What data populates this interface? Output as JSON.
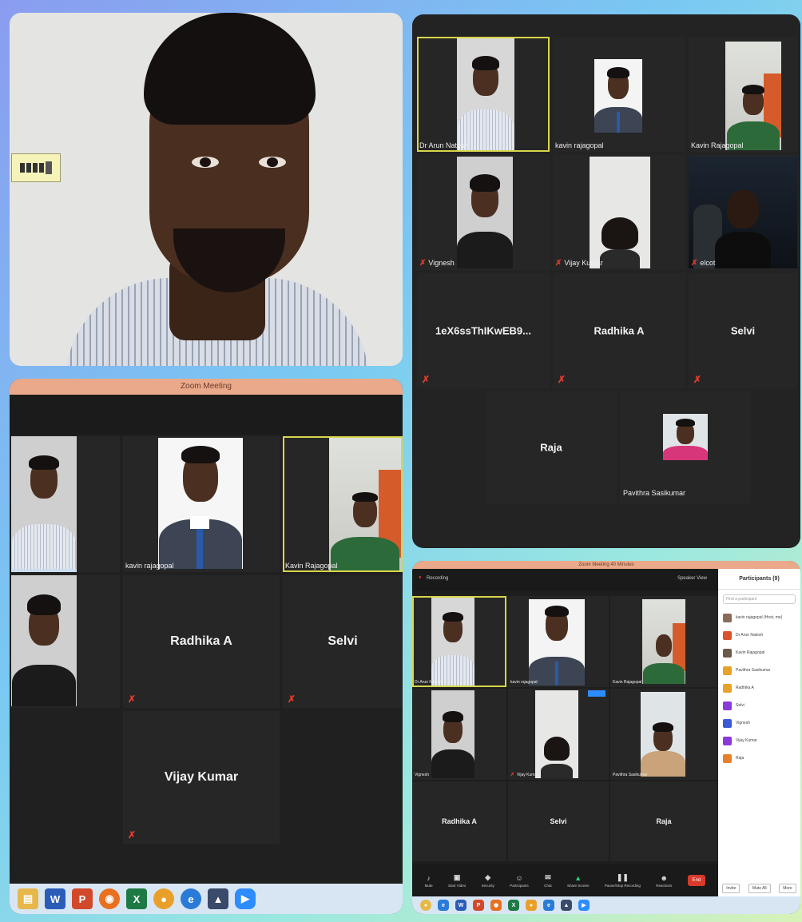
{
  "zoom_meeting_title": "Zoom Meeting",
  "zoom_participants_title": "Zoom Meeting 40 Minutes",
  "panel_b": {
    "tiles": [
      {
        "name": "Dr Arun Natesh",
        "video": true,
        "highlight": true
      },
      {
        "name": "kavin rajagopal",
        "video": true
      },
      {
        "name": "Kavin Rajagopal",
        "video": true
      },
      {
        "name": "Vignesh",
        "video": true,
        "muted": true
      },
      {
        "name": "Vijay Kumar",
        "video": true,
        "muted": true
      },
      {
        "name": "elcot",
        "video": true,
        "muted": true
      },
      {
        "name": "1eX6ssThIKwEB9...",
        "video": false,
        "muted": true
      },
      {
        "name": "Radhika A",
        "video": false,
        "muted": true
      },
      {
        "name": "Selvi",
        "video": false,
        "muted": true
      },
      {
        "name": "Raja",
        "video": false
      },
      {
        "name": "Pavithra Sasikumar",
        "video": true
      }
    ]
  },
  "panel_c": {
    "tiles": [
      {
        "name": "",
        "video": true
      },
      {
        "name": "kavin rajagopal",
        "video": true
      },
      {
        "name": "Kavin Rajagopal",
        "video": true,
        "highlight": true
      },
      {
        "name": "",
        "video": true
      },
      {
        "name": "Radhika A",
        "video": false,
        "muted": true
      },
      {
        "name": "Selvi",
        "video": false,
        "muted": true
      },
      {
        "name": "Vijay Kumar",
        "video": false,
        "muted": true
      }
    ],
    "taskbar_icons": [
      "file-explorer-icon",
      "word-icon",
      "powerpoint-icon",
      "firefox-icon",
      "excel-icon",
      "chrome-icon",
      "ie-icon",
      "vlc-icon",
      "zoom-icon"
    ]
  },
  "panel_d": {
    "top_left": "Recording",
    "top_right": "Speaker View",
    "tiles": [
      {
        "name": "Dr Arun Natesh",
        "video": true,
        "highlight": true
      },
      {
        "name": "kavin rajagopal",
        "video": true
      },
      {
        "name": "Kavin Rajagopal",
        "video": true
      },
      {
        "name": "Vignesh",
        "video": true
      },
      {
        "name": "Vijay Kumar",
        "video": true,
        "muted": true
      },
      {
        "name": "Pavithra Sasikumar",
        "video": true
      },
      {
        "name": "Radhika A",
        "video": false
      },
      {
        "name": "Selvi",
        "video": false
      },
      {
        "name": "Raja",
        "video": false
      }
    ],
    "toolbar": [
      "Mute",
      "Start Video",
      "Security",
      "Participants",
      "Chat",
      "Share Screen",
      "Pause/Stop Recording",
      "Reactions",
      "End"
    ],
    "sidebar": {
      "title": "Participants (9)",
      "search_placeholder": "Find a participant",
      "participants": [
        {
          "name": "kavin rajagopal (Host, me)",
          "color": "#8a6a5a"
        },
        {
          "name": "Dr Arun Natesh",
          "color": "#d9542a"
        },
        {
          "name": "Kavin Rajagopal",
          "color": "#6a5a4a"
        },
        {
          "name": "Pavithra Sasikumar",
          "color": "#e8a22a"
        },
        {
          "name": "Radhika A",
          "color": "#e8a22a"
        },
        {
          "name": "Selvi",
          "color": "#8a3ad9"
        },
        {
          "name": "Vignesh",
          "color": "#3a5ad9"
        },
        {
          "name": "Vijay Kumar",
          "color": "#8a3ad9"
        },
        {
          "name": "Raja",
          "color": "#e8802a"
        }
      ],
      "footer": [
        "Invite",
        "Mute All",
        "More"
      ]
    }
  }
}
